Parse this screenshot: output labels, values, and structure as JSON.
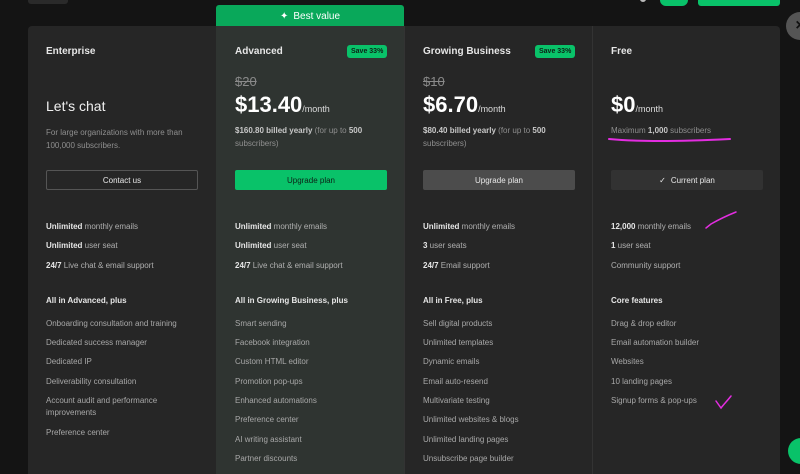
{
  "best_value": "Best value",
  "plans": [
    {
      "name": "Enterprise",
      "headline": "Let's chat",
      "subtitle": "For large organizations with more than 100,000 subscribers.",
      "button": "Contact us",
      "limits": [
        {
          "strong": "Unlimited",
          "rest": " monthly emails"
        },
        {
          "strong": "Unlimited",
          "rest": " user seat"
        },
        {
          "strong": "24/7",
          "rest": " Live chat & email support"
        }
      ],
      "features_heading": "All in Advanced, plus",
      "features": [
        "Onboarding consultation and training",
        "Dedicated success manager",
        "Dedicated IP",
        "Deliverability consultation",
        "Account audit and performance improvements",
        "Preference center"
      ]
    },
    {
      "name": "Advanced",
      "save": "Save 33%",
      "old_price": "$20",
      "price": "$13.40",
      "per": "/month",
      "billed_strong": "$160.80 billed yearly",
      "billed_rest": " (for up to ",
      "billed_num": "500",
      "billed_tail": " subscribers)",
      "button": "Upgrade plan",
      "limits": [
        {
          "strong": "Unlimited",
          "rest": " monthly emails"
        },
        {
          "strong": "Unlimited",
          "rest": " user seat"
        },
        {
          "strong": "24/7",
          "rest": " Live chat & email support"
        }
      ],
      "features_heading": "All in Growing Business, plus",
      "features": [
        "Smart sending",
        "Facebook integration",
        "Custom HTML editor",
        "Promotion pop-ups",
        "Enhanced automations",
        "Preference center",
        "AI writing assistant",
        "Partner discounts"
      ]
    },
    {
      "name": "Growing Business",
      "save": "Save 33%",
      "old_price": "$10",
      "price": "$6.70",
      "per": "/month",
      "billed_strong": "$80.40 billed yearly",
      "billed_rest": " (for up to ",
      "billed_num": "500",
      "billed_tail": " subscribers)",
      "button": "Upgrade plan",
      "limits": [
        {
          "strong": "Unlimited",
          "rest": " monthly emails"
        },
        {
          "strong": "3",
          "rest": " user seats"
        },
        {
          "strong": "24/7",
          "rest": " Email support"
        }
      ],
      "features_heading": "All in Free, plus",
      "features": [
        "Sell digital products",
        "Unlimited templates",
        "Dynamic emails",
        "Email auto-resend",
        "Multivariate testing",
        "Unlimited websites & blogs",
        "Unlimited landing pages",
        "Unsubscribe page builder"
      ]
    },
    {
      "name": "Free",
      "price": "$0",
      "per": "/month",
      "sub_pre": "Maximum ",
      "sub_strong": "1,000",
      "sub_post": " subscribers",
      "button": "Current plan",
      "limits": [
        {
          "strong": "12,000",
          "rest": " monthly emails"
        },
        {
          "strong": "1",
          "rest": " user seat"
        },
        {
          "strong": "",
          "rest": "Community support"
        }
      ],
      "features_heading": "Core features",
      "features": [
        "Drag & drop editor",
        "Email automation builder",
        "Websites",
        "10 landing pages",
        "Signup forms & pop-ups"
      ]
    }
  ],
  "colors": {
    "accent": "#09c269",
    "annotation": "#e32de0"
  },
  "icons": {
    "sparkle": "sparkle-icon",
    "check": "check-icon",
    "close": "close-icon",
    "chat": "chat-bubble-icon"
  }
}
